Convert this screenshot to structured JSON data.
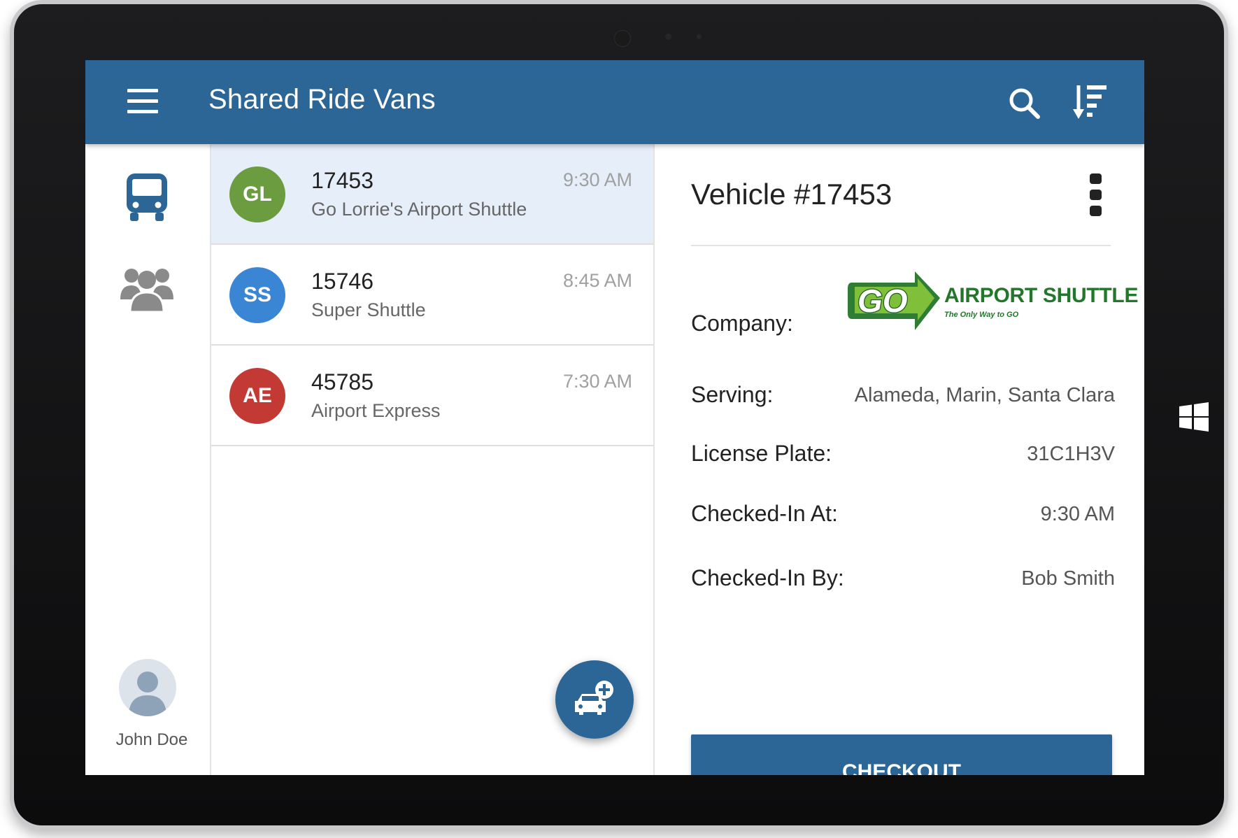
{
  "app_bar": {
    "title": "Shared Ride Vans",
    "menu_icon": "hamburger-menu-icon",
    "search_icon": "search-icon",
    "sort_icon": "sort-icon"
  },
  "left_rail": {
    "items": [
      {
        "icon": "bus-icon",
        "active": true
      },
      {
        "icon": "people-icon",
        "active": false
      }
    ],
    "user": {
      "name": "John Doe",
      "icon": "user-avatar-icon"
    }
  },
  "vehicle_list": {
    "items": [
      {
        "initials": "GL",
        "number": "17453",
        "company": "Go Lorrie's Airport Shuttle",
        "time": "9:30 AM",
        "color": "#6b9c3f",
        "selected": true
      },
      {
        "initials": "SS",
        "number": "15746",
        "company": "Super Shuttle",
        "time": "8:45 AM",
        "color": "#3a86d4",
        "selected": false
      },
      {
        "initials": "AE",
        "number": "45785",
        "company": "Airport Express",
        "time": "7:30 AM",
        "color": "#c33a35",
        "selected": false
      }
    ],
    "fab_icon": "add-vehicle-icon"
  },
  "detail": {
    "title": "Vehicle #17453",
    "more_icon": "more-vert-icon",
    "company": {
      "label": "Company:",
      "logo": {
        "mark": "GO",
        "name": "AIRPORT SHUTTLE",
        "tagline": "The Only Way to GO"
      }
    },
    "fields": [
      {
        "label": "Serving:",
        "value": "Alameda, Marin, Santa Clara"
      },
      {
        "label": "License Plate:",
        "value": "31C1H3V"
      },
      {
        "label": "Checked-In At:",
        "value": "9:30 AM"
      },
      {
        "label": "Checked-In By:",
        "value": "Bob Smith"
      }
    ],
    "checkout_label": "CHECKOUT"
  },
  "colors": {
    "primary": "#2b6696",
    "selected_row": "#e6eef9",
    "logo_green": "#22772a"
  }
}
